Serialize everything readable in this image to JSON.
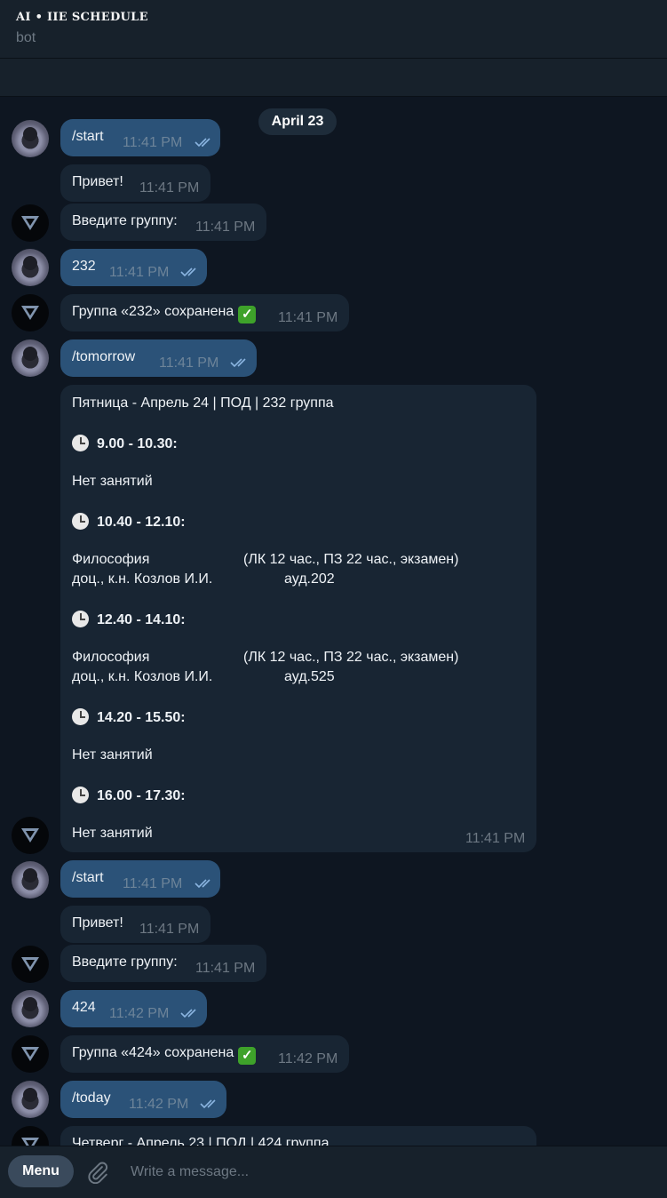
{
  "header": {
    "title": "AI • IIE SCHEDULE",
    "subtitle": "bot"
  },
  "chat": {
    "date_pill": "April 23",
    "messages": [
      {
        "text": "/start",
        "time": "11:41 PM"
      },
      {
        "text": "Привет!",
        "time": "11:41 PM"
      },
      {
        "text": "Введите группу:",
        "time": "11:41 PM"
      },
      {
        "text": "232",
        "time": "11:41 PM"
      },
      {
        "text": "Группа «232» сохранена",
        "time": "11:41 PM"
      },
      {
        "text": "/tomorrow",
        "time": "11:41 PM"
      },
      {
        "text": "/start",
        "time": "11:41 PM"
      },
      {
        "text": "Привет!",
        "time": "11:41 PM"
      },
      {
        "text": "Введите группу:",
        "time": "11:41 PM"
      },
      {
        "text": "424",
        "time": "11:42 PM"
      },
      {
        "text": "Группа «424» сохранена",
        "time": "11:42 PM"
      },
      {
        "text": "/today",
        "time": "11:42 PM"
      },
      {
        "text": "Четверг - Апрель 23 | ПОД | 424 группа"
      }
    ],
    "schedule": {
      "title": "Пятница - Апрель 24 | ПОД | 232 группа",
      "time": "11:41 PM",
      "slots": [
        {
          "time": "9.00 - 10.30:",
          "lines": [
            "Нет занятий"
          ]
        },
        {
          "time": "10.40 - 12.10:",
          "lines": [
            "Философия",
            "(ЛК 12 час., ПЗ 22 час., экзамен)",
            "доц., к.н. Козлов И.И.",
            "ауд.202"
          ]
        },
        {
          "time": "12.40 - 14.10:",
          "lines": [
            "Философия",
            "(ЛК 12 час., ПЗ 22 час., экзамен)",
            "доц., к.н. Козлов И.И.",
            "ауд.525"
          ]
        },
        {
          "time": "14.20 - 15.50:",
          "lines": [
            "Нет занятий"
          ]
        },
        {
          "time": "16.00 - 17.30:",
          "lines": [
            "Нет занятий"
          ]
        }
      ]
    }
  },
  "composer": {
    "menu_label": "Menu",
    "placeholder": "Write a message..."
  },
  "icons": [
    "double-check-icon",
    "check-mark-emoji-icon",
    "clock-emoji-icon",
    "paperclip-icon",
    "bot-logo-icon"
  ],
  "colors": {
    "outgoing": "#2b5278",
    "incoming": "#182533",
    "background": "#0e1621",
    "header": "#17212b"
  }
}
